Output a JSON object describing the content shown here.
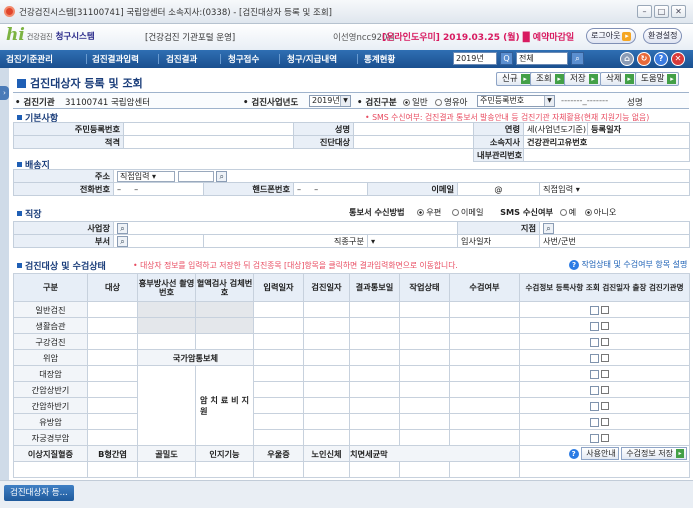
{
  "window": {
    "title": "건강검진시스템[31100741] 국립암센터 소속지사:(0338) - [검진대상자 등록 및 조회]",
    "controls": [
      "–",
      "□",
      "✕"
    ]
  },
  "header": {
    "logo_hi": "hi",
    "logo_sub": "건강검진",
    "logo_system": "청구시스템",
    "portal_link": "[건강검진 기관포털 운영]",
    "user": "이선영ncc920님",
    "notice": "[온라인도우미] 2019.03.25 (월) █ 예약마감일",
    "logout": "로그아웃",
    "settings": "환경설정"
  },
  "menu": {
    "items": [
      "검진기준관리",
      "검진결과입력",
      "검진결과",
      "청구접수",
      "청구/지급내역",
      "통계현황"
    ],
    "year": "2019년",
    "all": "전체",
    "q_icon": "Q"
  },
  "page": {
    "title": "검진대상자 등록 및 조회",
    "actions": [
      "신규",
      "조회",
      "저장",
      "삭제",
      "도움말"
    ]
  },
  "org": {
    "org_label": "• 검진기관",
    "org_value": "31100741 국립암센터",
    "year_label": "• 검진사업년도",
    "year_value": "2019년",
    "type_label": "• 검진구분",
    "type_general": "일반",
    "type_infant": "영유아",
    "id_select": "주민등록번호",
    "id_placeholder": "-------_-------",
    "name_label": "성명"
  },
  "basic": {
    "title": "기본사항",
    "note": "• SMS 수신여부: 검진결과 통보서 발송안내 등 검진기관 자체활용(현재 지원기능 없음)",
    "rrn": "주민등록번호",
    "name": "성명",
    "age": "연령",
    "age_value": "세(사업년도기준)",
    "reg_date": "등록일자",
    "qualification": "적격",
    "exam_target": "진단대상",
    "branch": "소속지사",
    "mgmt_no": "건강관리고유번호",
    "internal_no": "내부관리번호"
  },
  "shipping": {
    "title": "배송지",
    "address": "주소",
    "address_select": "직접입력",
    "phone": "전화번호",
    "mobile": "핸드폰번호",
    "email": "이메일",
    "at": "@",
    "email_select": "직접입력",
    "notice_method": "통보서 수신방법",
    "post": "우편",
    "email_opt": "이메일",
    "sms": "SMS 수신여부",
    "yes": "예",
    "no": "아니오"
  },
  "work": {
    "title": "직장",
    "company": "사업장",
    "branch": "지점",
    "dept": "부서",
    "position": "직종구분",
    "join_date": "입사일자",
    "emp_no": "사번/군번"
  },
  "exam": {
    "title": "검진대상 및 수검상태",
    "note": "• 대상자 정보를 입력하고 저장한 뒤 검진종목 [대상]항목을 클릭하면 결과입력화면으로 이동합니다.",
    "legend": "작업상태 및 수검여부 항목 설명",
    "headers": [
      "구분",
      "대상",
      "흉부방사선 촬영번호",
      "혈액검사 검체번호",
      "입력일자",
      "검진일자",
      "결과통보일",
      "작업상태",
      "수검여부",
      "수검정보 등록사항 조회 검진일자 출장 검진기관명"
    ],
    "rows": [
      "일반검진",
      "생활습관",
      "구강검진",
      "위암",
      "대장암",
      "간암상반기",
      "간암하반기",
      "유방암",
      "자궁경부암"
    ],
    "cancer_support": "국가암통보체",
    "vertical": "암 치 료 비 지 원",
    "bottom_labels": [
      "이상지질혈증",
      "B형간염",
      "골밀도",
      "인지기능",
      "우울증",
      "노인신체",
      "치면세균막"
    ],
    "help_btn": "사용안내",
    "save_btn": "수검정보 저장"
  },
  "taskbar": {
    "tab": "검진대상자 등..."
  },
  "colors": {
    "menubar": "#1f5a9c",
    "accent_red": "#e84a5f",
    "label_bg": "#e9eff7",
    "section_blue": "#1a3d7a"
  }
}
